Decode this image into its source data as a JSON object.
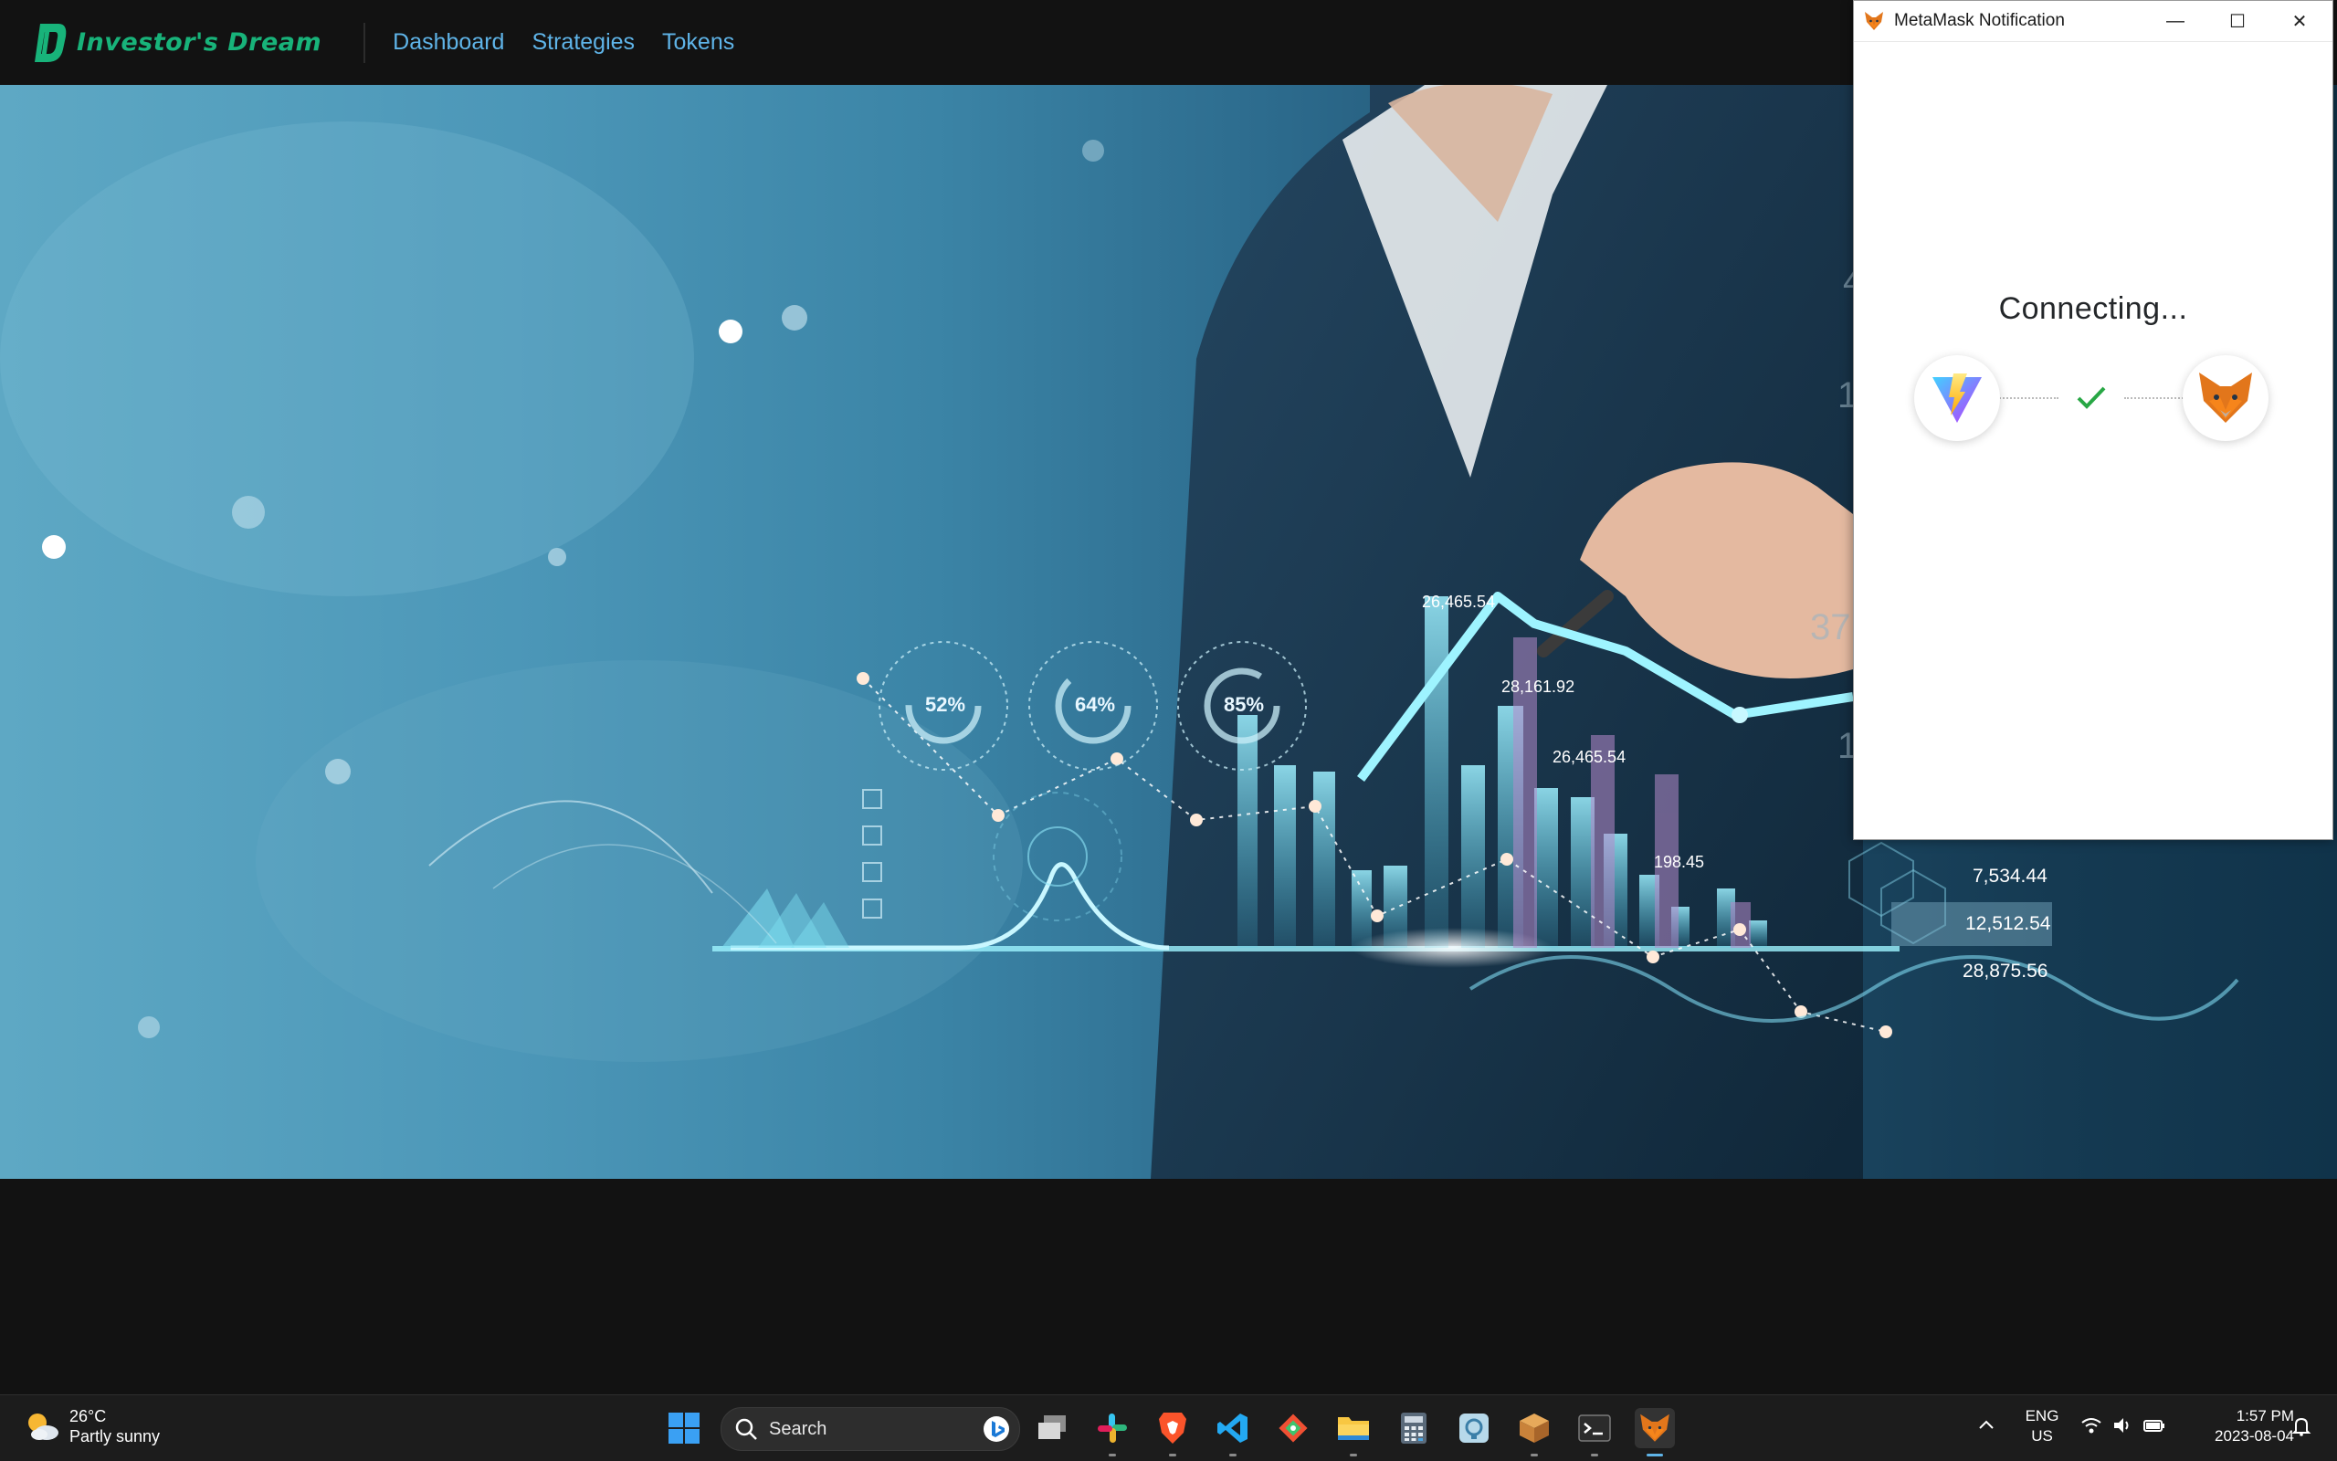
{
  "app": {
    "brand_name": "Investor's Dream",
    "nav": [
      "Dashboard",
      "Strategies",
      "Tokens"
    ],
    "brand_color": "#18b37a",
    "nav_color": "#5fb4e8"
  },
  "hero": {
    "gauges": [
      "52%",
      "64%",
      "85%"
    ],
    "chart_labels": [
      "26,465.54",
      "28,161.92",
      "26,465.54",
      "198.45"
    ],
    "side_values": [
      "7,534.44",
      "12,512.54",
      "28,875.56"
    ],
    "edge_digits": [
      "4",
      "1",
      "37",
      "1"
    ]
  },
  "metamask": {
    "window_title": "MetaMask Notification",
    "status": "Connecting...",
    "icons": [
      "vite-icon",
      "check-icon",
      "metamask-fox-icon"
    ],
    "check_color": "#28a745"
  },
  "taskbar": {
    "weather_temp": "26°C",
    "weather_desc": "Partly sunny",
    "search_placeholder": "Search",
    "apps": [
      "start-icon",
      "search-icon",
      "task-view-icon",
      "slack-icon",
      "brave-icon",
      "vscode-icon",
      "git-icon",
      "file-explorer-icon",
      "calculator-icon",
      "app-icon",
      "package-icon",
      "terminal-icon",
      "metamask-fox-icon"
    ],
    "language": "ENG",
    "region": "US",
    "time": "1:57 PM",
    "date": "2023-08-04"
  }
}
